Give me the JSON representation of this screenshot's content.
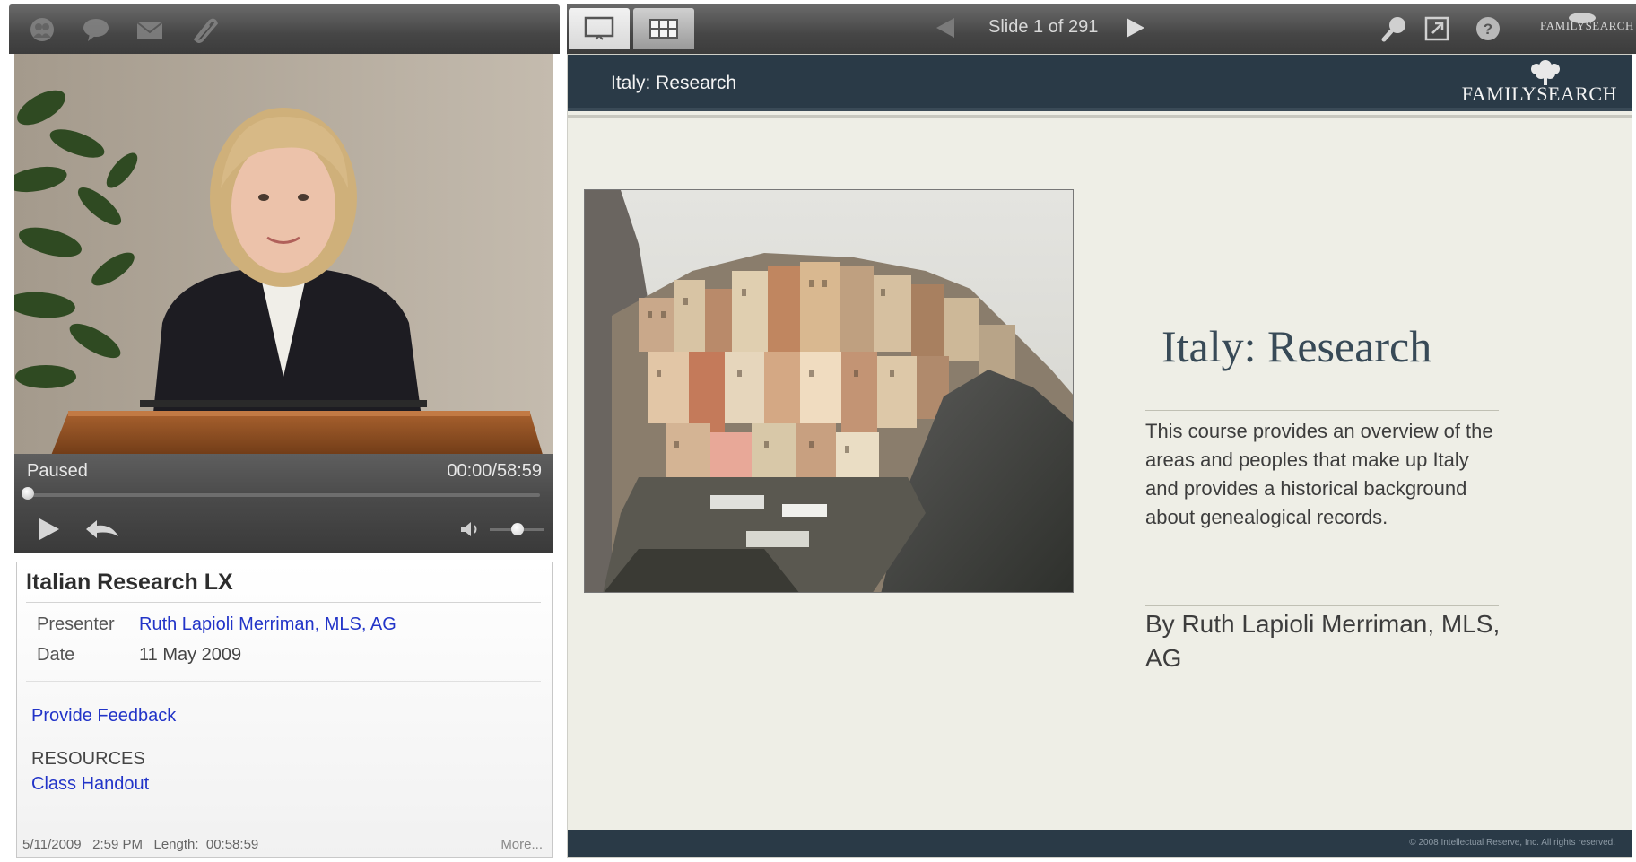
{
  "video": {
    "status": "Paused",
    "time": "00:00/58:59",
    "progress": 0
  },
  "course": {
    "title": "Italian Research LX",
    "presenter_label": "Presenter",
    "presenter_value": "Ruth Lapioli Merriman, MLS, AG",
    "date_label": "Date",
    "date_value": "11 May 2009",
    "feedback_link": "Provide Feedback",
    "resources_label": "RESOURCES",
    "handout_link": "Class Handout",
    "footer_meta": "5/11/2009   2:59 PM   Length:  00:58:59",
    "more_link": "More..."
  },
  "toolbar": {
    "slide_counter": "Slide 1 of 291",
    "brand_small": "FAMILYSEARCH"
  },
  "slide": {
    "header_title": "Italy: Research",
    "brand": "FAMILYSEARCH",
    "title": "Italy: Research",
    "description": "This course provides an overview of the areas and peoples that make up Italy and provides a historical background about genealogical records.",
    "author": "By Ruth Lapioli Merriman, MLS, AG",
    "copyright": "© 2008 Intellectual Reserve, Inc. All rights reserved."
  },
  "colors": {
    "link": "#2234c8",
    "slide_header": "#2a3a47",
    "slide_title": "#384a57"
  },
  "icons": [
    "group-icon",
    "chat-icon",
    "mail-icon",
    "attachment-icon",
    "slide-view-icon",
    "grid-view-icon",
    "prev-arrow-icon",
    "next-arrow-icon",
    "search-icon",
    "popout-icon",
    "help-icon",
    "play-icon",
    "replay-icon",
    "volume-icon"
  ]
}
